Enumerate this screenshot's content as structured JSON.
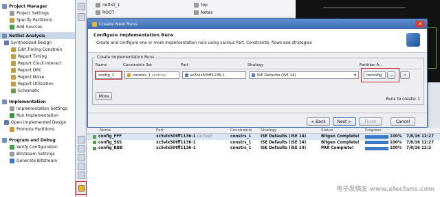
{
  "left_panel": {
    "sections": [
      {
        "title": "Project Manager",
        "items": [
          "Project Settings",
          "Specify Partitions",
          "Add Sources"
        ]
      },
      {
        "title": "Netlist Analysis",
        "items": [
          "Synthesized Design",
          "Edit Timing Constrain",
          "Report Timing",
          "Report Clock Interact",
          "Report DRC",
          "Report Noise",
          "Report Utilization",
          "Schematic"
        ]
      },
      {
        "title": "Implementation",
        "items": [
          "Implementation Settings",
          "Run Implementation",
          "Open Implemented Design",
          "Promote Partitions"
        ]
      },
      {
        "title": "Program and Debug",
        "items": [
          "Verify Configuration",
          "Bitstream Settings",
          "Generate Bitstream"
        ]
      }
    ]
  },
  "top_tabs": {
    "left_items": [
      "netlist_1",
      "ROOT"
    ],
    "right_items": [
      "top",
      "Notes"
    ]
  },
  "dialog": {
    "title": "Create New Runs",
    "heading": "Configure Implementation Runs",
    "description": "Create and configure one or more implementation runs using various Part, Constraints, flows and strategies",
    "group_label": "Create Implementation Runs",
    "columns": [
      "Name",
      "Constraints Set",
      "Part",
      "Strategy",
      "Partition A..."
    ],
    "row": {
      "name": "config_1",
      "constraints": "constrs_1",
      "constraints_note": "(active)",
      "part": "xc5vlx50tff1136-1",
      "strategy": "ISE Defaults (ISE 14)",
      "partition": "reconfig_",
      "browse": "..."
    },
    "more_label": "More",
    "runs_to_create_label": "Runs to create: 1",
    "back_label": "< Back",
    "next_label": "Next >",
    "finish_label": "Finish",
    "cancel_label": "Cancel"
  },
  "runs_table": {
    "columns": [
      "Name",
      "Part",
      "Constraints",
      "Strategy",
      "Status",
      "Progress",
      ""
    ],
    "rows": [
      {
        "name": "config_FFF",
        "part": "xc5vlx50tff1136-1",
        "note": "(active)",
        "constraints": "constrs_1",
        "strategy": "ISE Defaults (ISE 14)",
        "status": "Bitgen Complete!",
        "progress": 100,
        "pct": "100%",
        "date": "7/8/16 12:27"
      },
      {
        "name": "config_SSS",
        "part": "xc5vlx50tff1136-1",
        "note": "",
        "constraints": "constrs_1",
        "strategy": "ISE Defaults (ISE 14)",
        "status": "Bitgen Complete!",
        "progress": 100,
        "pct": "100%",
        "date": "7/8/16 12:27"
      },
      {
        "name": "config_BBB",
        "part": "xc5vlx50tff1136-1",
        "note": "",
        "constraints": "constrs_1",
        "strategy": "ISE Defaults (ISE 14)",
        "status": "PAR Complete!",
        "progress": 100,
        "pct": "100%",
        "date": "7/8/16 12:2"
      }
    ]
  },
  "watermark": "电子发烧友 www.elecfans.com",
  "colors": {
    "accent": "#3c6cb2",
    "highlight": "#d9262c",
    "progress": "#3a79c7"
  }
}
